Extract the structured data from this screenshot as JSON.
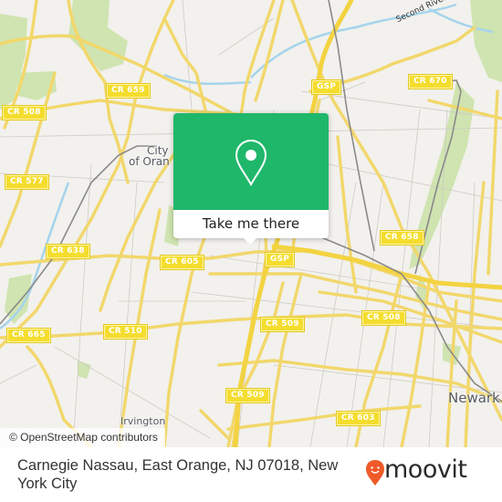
{
  "map": {
    "attribution": "© OpenStreetMap contributors",
    "road_shields": [
      {
        "id": "cr-659",
        "label": "CR 659"
      },
      {
        "id": "cr-508-west",
        "label": "CR 508"
      },
      {
        "id": "cr-577",
        "label": "CR 577"
      },
      {
        "id": "cr-638",
        "label": "CR 638"
      },
      {
        "id": "cr-605",
        "label": "CR 605"
      },
      {
        "id": "cr-665",
        "label": "CR 665"
      },
      {
        "id": "cr-510",
        "label": "CR 510"
      },
      {
        "id": "gsp-north",
        "label": "GSP"
      },
      {
        "id": "cr-670",
        "label": "CR 670"
      },
      {
        "id": "cr-658",
        "label": "CR 658"
      },
      {
        "id": "gsp-south",
        "label": "GSP"
      },
      {
        "id": "cr-509-north",
        "label": "CR 509"
      },
      {
        "id": "cr-508-east",
        "label": "CR 508"
      },
      {
        "id": "cr-509-south",
        "label": "CR 509"
      },
      {
        "id": "cr-603",
        "label": "CR 603"
      }
    ],
    "places": {
      "city_of_orange_line1": "City",
      "city_of_orange_line2": "of Oran",
      "irvington": "Irvington",
      "newark": "Newark",
      "second_river": "Second River"
    },
    "colors": {
      "background": "#f2f1ed",
      "road": "#f7e27a",
      "park": "#cfe4b0",
      "water": "#a6d4ec",
      "rail": "#8a8a8a"
    }
  },
  "popup": {
    "pin_icon": "map-pin-icon",
    "action_label": "Take me there",
    "accent_color": "#1fb76a"
  },
  "footer": {
    "address": "Carnegie Nassau, East Orange, NJ 07018, New York City",
    "logo_text": "moovit",
    "logo_color": "#f05a28"
  }
}
